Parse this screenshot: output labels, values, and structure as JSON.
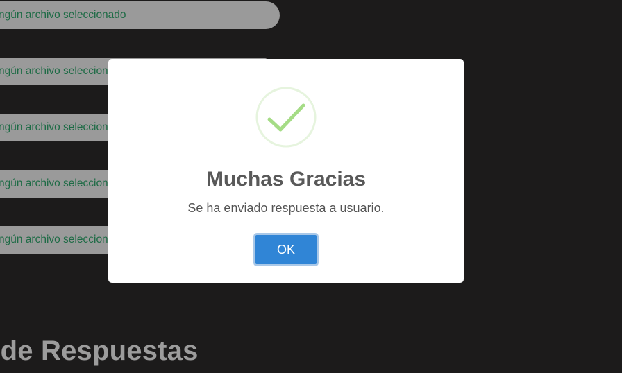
{
  "file_inputs": [
    {
      "status_text": "ngún archivo seleccionado"
    },
    {
      "status_text": "ngún archivo seleccionado"
    },
    {
      "status_text": "ngún archivo seleccionado"
    },
    {
      "status_text": "ngún archivo seleccionado"
    },
    {
      "status_text": "ngún archivo seleccionado"
    }
  ],
  "page": {
    "section_heading": "l de Respuestas"
  },
  "dialog": {
    "icon": "success-check-icon",
    "title": "Muchas Gracias",
    "message": "Se ha enviado respuesta a usuario.",
    "confirm_label": "OK"
  },
  "colors": {
    "background": "#1c1b1b",
    "file_field_bg": "#9a9a9a",
    "file_field_text": "#1d6b45",
    "confirm_button": "#3085d6",
    "success_icon": "#a5dc86"
  }
}
